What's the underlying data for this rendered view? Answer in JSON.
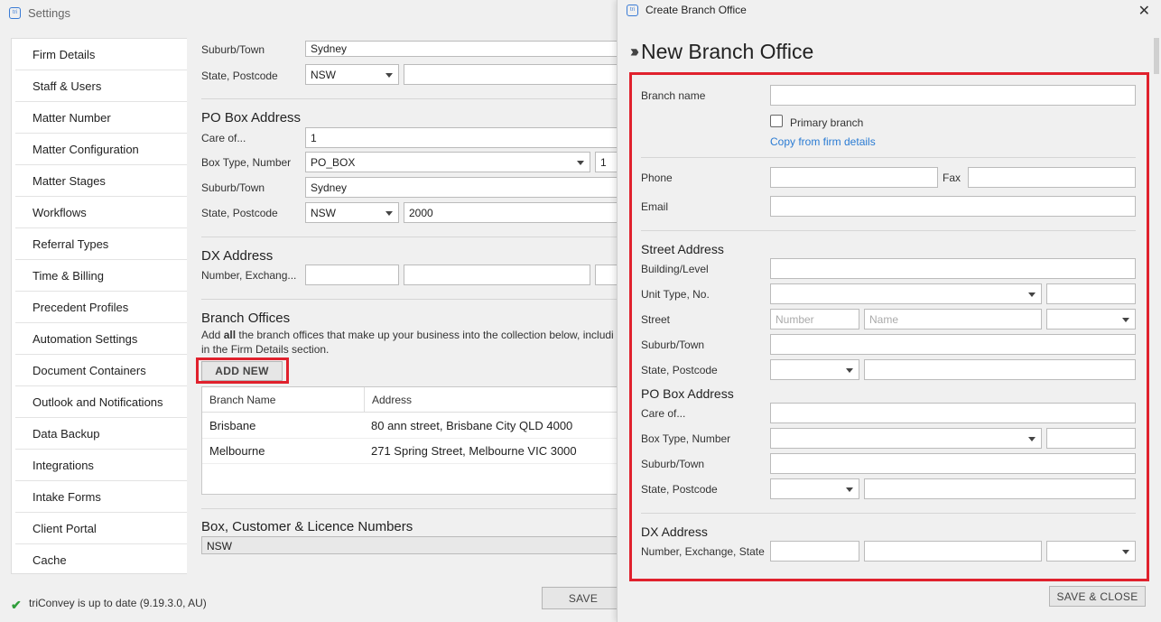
{
  "main": {
    "title": "Settings",
    "sidebar": [
      "Firm Details",
      "Staff & Users",
      "Matter Number",
      "Matter Configuration",
      "Matter Stages",
      "Workflows",
      "Referral Types",
      "Time & Billing",
      "Precedent Profiles",
      "Automation Settings",
      "Document Containers",
      "Outlook and Notifications",
      "Data Backup",
      "Integrations",
      "Intake Forms",
      "Client Portal",
      "Cache"
    ],
    "street_top": {
      "suburb_label": "Suburb/Town",
      "suburb_value": "Sydney",
      "state_label": "State, Postcode",
      "state_value": "NSW"
    },
    "po_box": {
      "heading": "PO Box Address",
      "care_label": "Care of...",
      "care_value": "1",
      "box_label": "Box Type, Number",
      "box_type": "PO_BOX",
      "box_number": "1",
      "suburb_label": "Suburb/Town",
      "suburb_value": "Sydney",
      "state_label": "State, Postcode",
      "state_value": "NSW",
      "postcode_value": "2000"
    },
    "dx": {
      "heading": "DX Address",
      "label": "Number, Exchang..."
    },
    "branch": {
      "heading": "Branch Offices",
      "desc_pre": "Add ",
      "desc_bold": "all",
      "desc_post": " the branch offices that make up your business into the collection below, includi",
      "desc_line2": "in the Firm Details section.",
      "add_new": "ADD NEW",
      "col_name": "Branch Name",
      "col_address": "Address",
      "rows": [
        {
          "name": "Brisbane",
          "address": "80 ann street, Brisbane City QLD 4000"
        },
        {
          "name": "Melbourne",
          "address": "271 Spring Street, Melbourne VIC 3000"
        }
      ]
    },
    "licence": {
      "heading": "Box, Customer & Licence Numbers",
      "state_value": "NSW"
    },
    "status": "triConvey is up to date (9.19.3.0, AU)",
    "save": "SAVE"
  },
  "dialog": {
    "title": "Create Branch Office",
    "heading": "New Branch Office",
    "branch_name_label": "Branch name",
    "primary_label": "Primary branch",
    "copy_link": "Copy from firm details",
    "phone_label": "Phone",
    "fax_label": "Fax",
    "email_label": "Email",
    "street_heading": "Street Address",
    "building_label": "Building/Level",
    "unit_label": "Unit Type, No.",
    "street_label": "Street",
    "street_number_ph": "Number",
    "street_name_ph": "Name",
    "suburb_label": "Suburb/Town",
    "state_label": "State, Postcode",
    "po_heading": "PO Box Address",
    "care_label": "Care of...",
    "box_label": "Box Type, Number",
    "po_suburb_label": "Suburb/Town",
    "po_state_label": "State, Postcode",
    "dx_heading": "DX Address",
    "dx_label": "Number, Exchange, State",
    "save_close": "SAVE & CLOSE"
  }
}
